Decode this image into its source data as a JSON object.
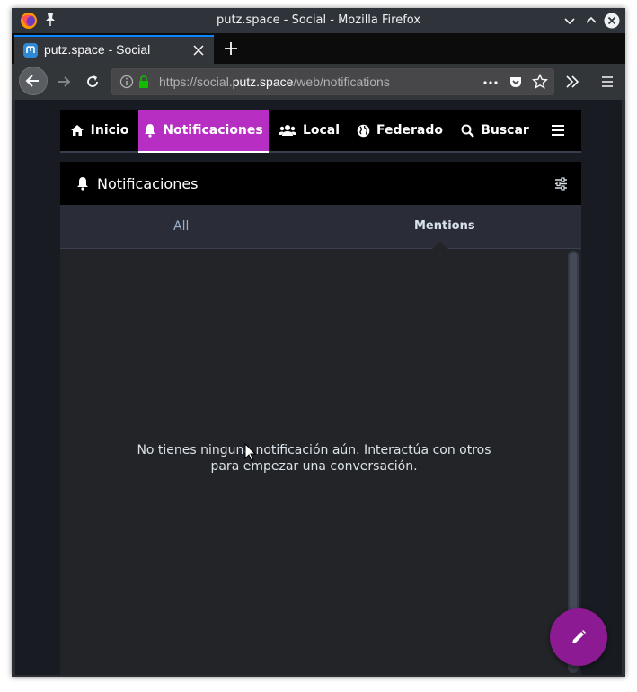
{
  "window": {
    "title": "putz.space - Social - Mozilla Firefox"
  },
  "tab": {
    "label": "putz.space - Social"
  },
  "urlbar": {
    "url_prefix": "https://social.",
    "url_host": "putz.space",
    "url_path": "/web/notifications"
  },
  "nav": {
    "items": [
      {
        "label": "Inicio",
        "icon": "home-icon"
      },
      {
        "label": "Notificaciones",
        "icon": "bell-icon",
        "active": true
      },
      {
        "label": "Local",
        "icon": "users-icon"
      },
      {
        "label": "Federado",
        "icon": "globe-icon"
      },
      {
        "label": "Buscar",
        "icon": "search-icon"
      }
    ],
    "menu_icon": "menu-icon"
  },
  "column": {
    "title": "Notificaciones",
    "filters": {
      "all": "All",
      "mentions": "Mentions",
      "active": "mentions"
    },
    "empty_line1": "No tienes ninguna notificación aún. Interactúa con otros",
    "empty_line2": "para empezar una conversación."
  },
  "colors": {
    "accent": "#b62fc2",
    "compose": "#8c1a92",
    "firefox_tab_highlight": "#0a84ff"
  }
}
